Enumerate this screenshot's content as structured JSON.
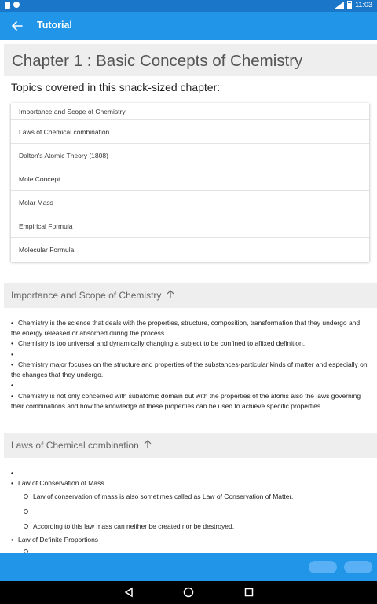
{
  "status_bar": {
    "time": "11:03"
  },
  "app_bar": {
    "title": "Tutorial"
  },
  "chapter": {
    "title": "Chapter 1 : Basic Concepts of Chemistry",
    "topics_heading": "Topics covered in this snack-sized chapter:",
    "topics": [
      "Importance and Scope of Chemistry",
      "Laws of Chemical combination",
      "Dalton's Atomic Theory (1808)",
      "Mole Concept",
      "Molar Mass",
      "Empirical Formula",
      "Molecular Formula"
    ]
  },
  "sections": [
    {
      "title": "Importance and Scope of Chemistry",
      "bullets": [
        "Chemistry is the science that deals with the properties, structure, composition, transformation that they undergo and the energy released or absorbed during the process.",
        "Chemistry is too universal and dynamically changing a subject to be confined to affixed definition.",
        "",
        "Chemistry major focuses on the structure and properties of the substances-particular kinds of matter and especially on the changes that they undergo.",
        "",
        "Chemistry is not only concerned with subatomic domain but with the properties of the atoms also the laws governing their combinations and how the knowledge of these properties can be used to achieve specific properties."
      ]
    },
    {
      "title": "Laws of Chemical combination",
      "items": [
        "",
        "Law of Conservation of Mass",
        "Law of conservation of mass is also sometimes called as Law of Conservation of Matter.",
        "",
        "According to this law mass can neither be created nor be destroyed.",
        "Law of Definite Proportions"
      ]
    }
  ],
  "icons": {
    "back": "arrow-left-icon",
    "section_up": "arrow-up-icon",
    "nav_back": "triangle-back-icon",
    "nav_home": "circle-home-icon",
    "nav_recent": "square-recents-icon"
  },
  "colors": {
    "status_bar": "#1976c8",
    "app_bar": "#2196e8",
    "section_header_bg": "#eeeeee"
  }
}
